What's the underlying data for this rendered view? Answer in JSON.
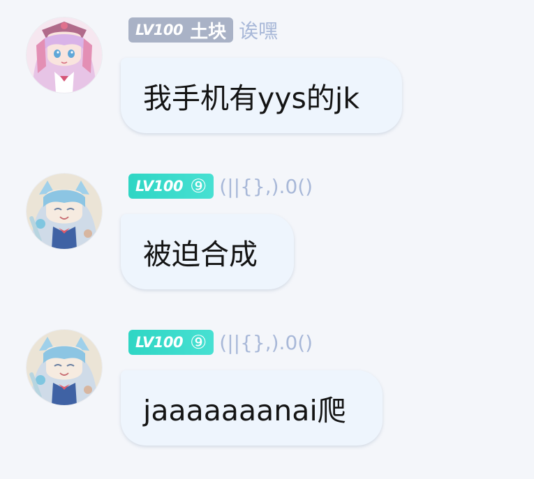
{
  "messages": [
    {
      "avatar": "pink-haired-anime-girl-avatar",
      "level": "LV100",
      "title": "土块",
      "nickname": "诶嘿",
      "text": "我手机有yys的jk"
    },
    {
      "avatar": "blue-haired-anime-fairy-avatar",
      "level": "LV100",
      "title": "⑨",
      "nickname": "(||{},).0()",
      "text": "被迫合成"
    },
    {
      "avatar": "blue-haired-anime-fairy-avatar",
      "level": "LV100",
      "title": "⑨",
      "nickname": "(||{},).0()",
      "text": "jaaaaaaanai爬"
    }
  ],
  "colors": {
    "background": "#f4f6fa",
    "bubble": "#eef5fd",
    "badge_grey": "#a9b2c6",
    "badge_teal": "#38dacb",
    "nickname": "#a8b8d8"
  }
}
